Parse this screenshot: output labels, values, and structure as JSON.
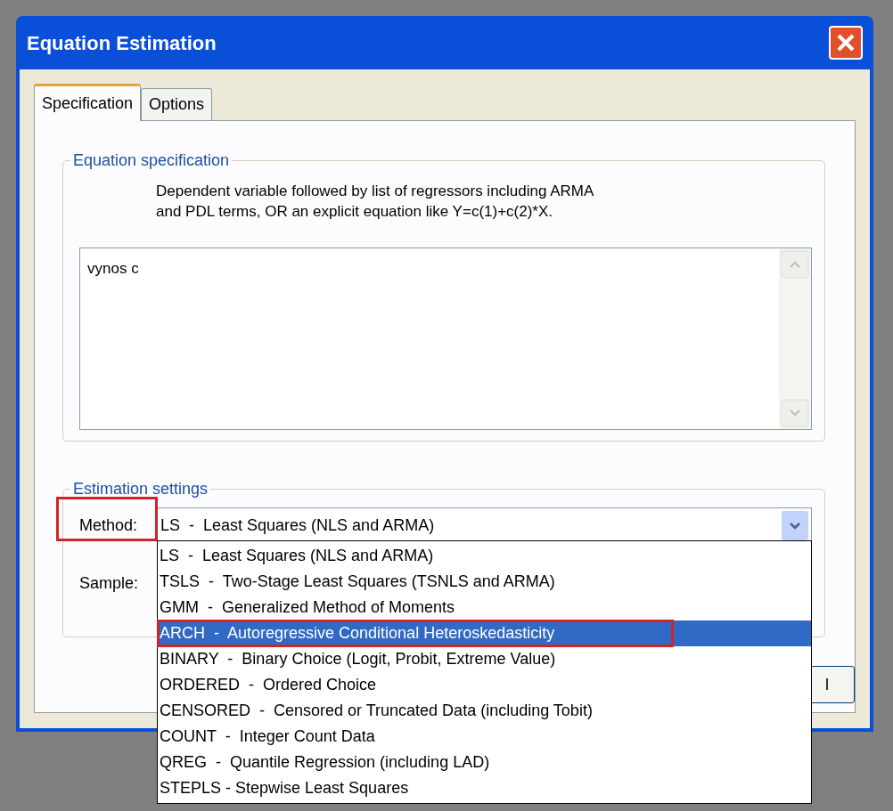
{
  "window": {
    "title": "Equation Estimation"
  },
  "tabs": [
    {
      "label": "Specification",
      "selected": true
    },
    {
      "label": "Options",
      "selected": false
    }
  ],
  "equation_group": {
    "title": "Equation specification",
    "hint_lines": [
      "Dependent variable followed by list of regressors including ARMA",
      "and PDL terms, OR an explicit equation like Y=c(1)+c(2)*X."
    ],
    "value": "vynos c"
  },
  "estimation_group": {
    "title": "Estimation settings",
    "method_label": "Method:",
    "method_value": "LS  -  Least Squares (NLS and ARMA)",
    "sample_label": "Sample:",
    "dropdown_open": true
  },
  "dropdown_items": [
    {
      "label": "LS  -  Least Squares (NLS and ARMA)",
      "selected": false
    },
    {
      "label": "TSLS  -  Two-Stage Least Squares (TSNLS and ARMA)",
      "selected": false
    },
    {
      "label": "GMM  -  Generalized Method of Moments",
      "selected": false
    },
    {
      "label": "ARCH  -  Autoregressive Conditional Heteroskedasticity",
      "selected": true
    },
    {
      "label": "BINARY  -  Binary Choice (Logit, Probit, Extreme Value)",
      "selected": false
    },
    {
      "label": "ORDERED  -  Ordered Choice",
      "selected": false
    },
    {
      "label": "CENSORED  -  Censored or Truncated Data (including Tobit)",
      "selected": false
    },
    {
      "label": "COUNT  -  Integer Count Data",
      "selected": false
    },
    {
      "label": "QREG  -  Quantile Regression (including LAD)",
      "selected": false
    },
    {
      "label": "STEPLS - Stepwise Least Squares",
      "selected": false
    }
  ],
  "buttons": [
    {
      "label": "l"
    }
  ]
}
